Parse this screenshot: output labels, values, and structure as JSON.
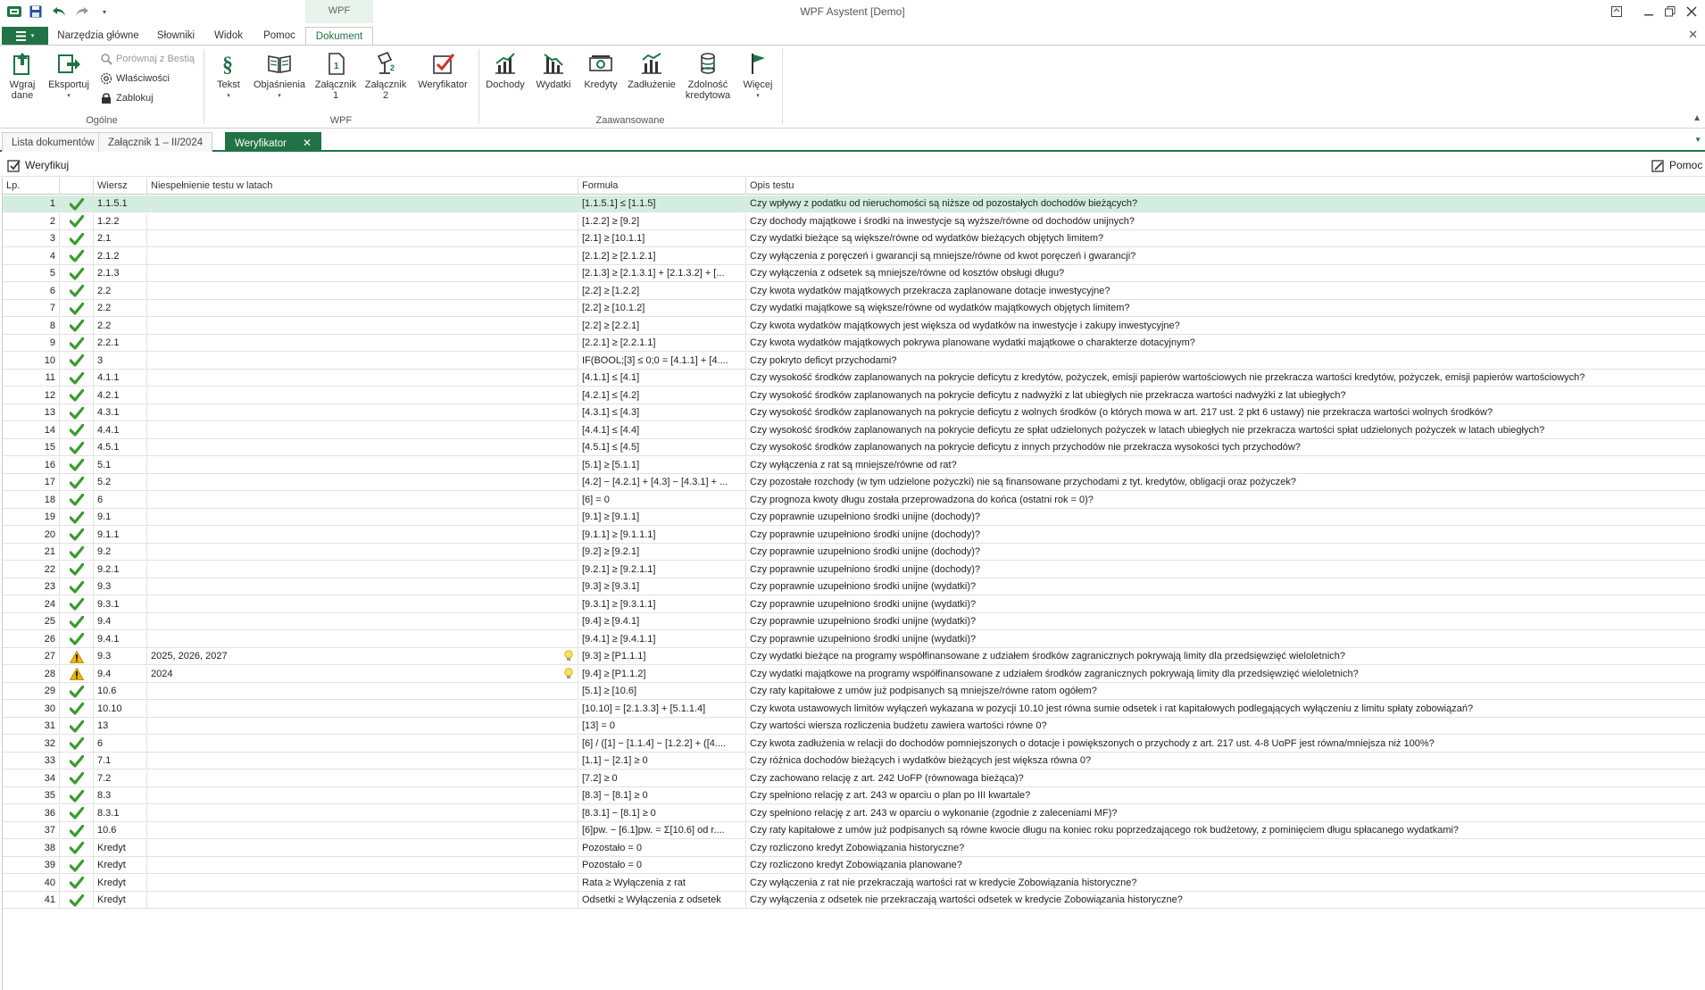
{
  "window": {
    "title": "WPF Asystent [Demo]",
    "context_tab": "WPF"
  },
  "ribbon_tabs": [
    "Narzędzia główne",
    "Słowniki",
    "Widok",
    "Pomoc",
    "Dokument"
  ],
  "ribbon": {
    "ogolne": {
      "label": "Ogólne",
      "wgraj_dane": "Wgraj\ndane",
      "eksportuj": "Eksportuj",
      "porownaj": "Porównaj z Bestią",
      "wlasciwosci": "Właściwości",
      "zablokuj": "Zablokuj"
    },
    "wpf": {
      "label": "WPF",
      "tekst": "Tekst",
      "objasnienia": "Objaśnienia",
      "zalacznik1": "Załącznik\n1",
      "zalacznik2": "Załącznik\n2",
      "weryfikator": "Weryfikator"
    },
    "zaawansowane": {
      "label": "Zaawansowane",
      "dochody": "Dochody",
      "wydatki": "Wydatki",
      "kredyty": "Kredyty",
      "zadluzenie": "Zadłużenie",
      "zdolnosc": "Zdolność\nkredytowa",
      "wiecej": "Więcej"
    }
  },
  "doc_tabs": [
    "Lista dokumentów",
    "Załącznik 1 – II/2024",
    "Weryfikator"
  ],
  "toolbar": {
    "weryfikuj": "Weryfikuj",
    "pomoc": "Pomoc"
  },
  "colors": {
    "accent": "#217346",
    "selected_row": "#d3eee0",
    "ok": "#3a9a2f",
    "warning": "#f0b400"
  },
  "table": {
    "columns": [
      "Lp.",
      "",
      "Wiersz",
      "Niespełnienie testu w latach",
      "Formuła",
      "Opis testu"
    ],
    "rows": [
      {
        "lp": "1",
        "status": "ok",
        "wiersz": "1.1.5.1",
        "lata": "",
        "formula": "[1.1.5.1] ≤ [1.1.5]",
        "opis": "Czy wpływy z podatku od nieruchomości są niższe od pozostałych dochodów bieżących?"
      },
      {
        "lp": "2",
        "status": "ok",
        "wiersz": "1.2.2",
        "lata": "",
        "formula": "[1.2.2] ≥ [9.2]",
        "opis": "Czy dochody majątkowe i środki na inwestycje są wyższe/równe od dochodów unijnych?"
      },
      {
        "lp": "3",
        "status": "ok",
        "wiersz": "2.1",
        "lata": "",
        "formula": "[2.1] ≥ [10.1.1]",
        "opis": "Czy wydatki bieżące są większe/równe od wydatków bieżących objętych limitem?"
      },
      {
        "lp": "4",
        "status": "ok",
        "wiersz": "2.1.2",
        "lata": "",
        "formula": "[2.1.2] ≥ [2.1.2.1]",
        "opis": "Czy wyłączenia z poręczeń i gwarancji są mniejsze/równe od kwot poręczeń i gwarancji?"
      },
      {
        "lp": "5",
        "status": "ok",
        "wiersz": "2.1.3",
        "lata": "",
        "formula": "[2.1.3] ≥ [2.1.3.1] + [2.1.3.2] + [...",
        "opis": "Czy wyłączenia z odsetek są mniejsze/równe od kosztów obsługi długu?"
      },
      {
        "lp": "6",
        "status": "ok",
        "wiersz": "2.2",
        "lata": "",
        "formula": "[2.2] ≥ [1.2.2]",
        "opis": "Czy kwota wydatków majątkowych przekracza zaplanowane dotacje inwestycyjne?"
      },
      {
        "lp": "7",
        "status": "ok",
        "wiersz": "2.2",
        "lata": "",
        "formula": "[2.2] ≥ [10.1.2]",
        "opis": "Czy wydatki majątkowe są większe/równe od wydatków majątkowych objętych limitem?"
      },
      {
        "lp": "8",
        "status": "ok",
        "wiersz": "2.2",
        "lata": "",
        "formula": "[2.2] ≥ [2.2.1]",
        "opis": "Czy kwota wydatków majątkowych jest większa od wydatków na inwestycje i zakupy inwestycyjne?"
      },
      {
        "lp": "9",
        "status": "ok",
        "wiersz": "2.2.1",
        "lata": "",
        "formula": "[2.2.1] ≥ [2.2.1.1]",
        "opis": "Czy kwota wydatków majątkowych pokrywa planowane wydatki majątkowe o charakterze dotacyjnym?"
      },
      {
        "lp": "10",
        "status": "ok",
        "wiersz": "3",
        "lata": "",
        "formula": "IF(BOOL;[3] ≤ 0;0 = [4.1.1] + [4....",
        "opis": "Czy pokryto deficyt przychodami?"
      },
      {
        "lp": "11",
        "status": "ok",
        "wiersz": "4.1.1",
        "lata": "",
        "formula": "[4.1.1] ≤ [4.1]",
        "opis": "Czy wysokość środków zaplanowanych na pokrycie deficytu z kredytów, pożyczek, emisji papierów wartościowych nie przekracza wartości kredytów, pożyczek, emisji papierów wartościowych?"
      },
      {
        "lp": "12",
        "status": "ok",
        "wiersz": "4.2.1",
        "lata": "",
        "formula": "[4.2.1] ≤ [4.2]",
        "opis": "Czy wysokość środków zaplanowanych na pokrycie deficytu z nadwyżki z lat ubiegłych nie przekracza wartości nadwyżki z lat ubiegłych?"
      },
      {
        "lp": "13",
        "status": "ok",
        "wiersz": "4.3.1",
        "lata": "",
        "formula": "[4.3.1] ≤ [4.3]",
        "opis": "Czy wysokość środków zaplanowanych na pokrycie deficytu z wolnych środków (o których mowa w art. 217 ust. 2 pkt 6 ustawy) nie przekracza wartości wolnych środków?"
      },
      {
        "lp": "14",
        "status": "ok",
        "wiersz": "4.4.1",
        "lata": "",
        "formula": "[4.4.1] ≤ [4.4]",
        "opis": "Czy wysokość środków zaplanowanych na pokrycie deficytu ze spłat udzielonych pożyczek w latach ubiegłych nie przekracza wartości spłat udzielonych pożyczek w latach ubiegłych?"
      },
      {
        "lp": "15",
        "status": "ok",
        "wiersz": "4.5.1",
        "lata": "",
        "formula": "[4.5.1] ≤ [4.5]",
        "opis": "Czy wysokość środków zaplanowanych na pokrycie deficytu z innych przychodów nie przekracza wysokości tych przychodów?"
      },
      {
        "lp": "16",
        "status": "ok",
        "wiersz": "5.1",
        "lata": "",
        "formula": "[5.1] ≥ [5.1.1]",
        "opis": "Czy wyłączenia z rat są mniejsze/równe od rat?"
      },
      {
        "lp": "17",
        "status": "ok",
        "wiersz": "5.2",
        "lata": "",
        "formula": "[4.2] − [4.2.1] + [4.3] − [4.3.1] + ...",
        "opis": "Czy pozostałe rozchody (w tym udzielone pożyczki) nie są finansowane przychodami z tyt. kredytów, obligacji oraz pożyczek?"
      },
      {
        "lp": "18",
        "status": "ok",
        "wiersz": "6",
        "lata": "",
        "formula": "[6] = 0",
        "opis": "Czy prognoza kwoty długu została przeprowadzona do końca (ostatni rok = 0)?"
      },
      {
        "lp": "19",
        "status": "ok",
        "wiersz": "9.1",
        "lata": "",
        "formula": "[9.1] ≥ [9.1.1]",
        "opis": "Czy poprawnie uzupełniono środki unijne (dochody)?"
      },
      {
        "lp": "20",
        "status": "ok",
        "wiersz": "9.1.1",
        "lata": "",
        "formula": "[9.1.1] ≥ [9.1.1.1]",
        "opis": "Czy poprawnie uzupełniono środki unijne (dochody)?"
      },
      {
        "lp": "21",
        "status": "ok",
        "wiersz": "9.2",
        "lata": "",
        "formula": "[9.2] ≥ [9.2.1]",
        "opis": "Czy poprawnie uzupełniono środki unijne (dochody)?"
      },
      {
        "lp": "22",
        "status": "ok",
        "wiersz": "9.2.1",
        "lata": "",
        "formula": "[9.2.1] ≥ [9.2.1.1]",
        "opis": "Czy poprawnie uzupełniono środki unijne (dochody)?"
      },
      {
        "lp": "23",
        "status": "ok",
        "wiersz": "9.3",
        "lata": "",
        "formula": "[9.3] ≥ [9.3.1]",
        "opis": "Czy poprawnie uzupełniono środki unijne (wydatki)?"
      },
      {
        "lp": "24",
        "status": "ok",
        "wiersz": "9.3.1",
        "lata": "",
        "formula": "[9.3.1] ≥ [9.3.1.1]",
        "opis": "Czy poprawnie uzupełniono środki unijne (wydatki)?"
      },
      {
        "lp": "25",
        "status": "ok",
        "wiersz": "9.4",
        "lata": "",
        "formula": "[9.4] ≥ [9.4.1]",
        "opis": "Czy poprawnie uzupełniono środki unijne (wydatki)?"
      },
      {
        "lp": "26",
        "status": "ok",
        "wiersz": "9.4.1",
        "lata": "",
        "formula": "[9.4.1] ≥ [9.4.1.1]",
        "opis": "Czy poprawnie uzupełniono środki unijne (wydatki)?"
      },
      {
        "lp": "27",
        "status": "warn",
        "wiersz": "9.3",
        "lata": "2025, 2026, 2027",
        "formula": "[9.3] ≥ [P1.1.1]",
        "opis": "Czy wydatki bieżące na programy współfinansowane z udziałem środków zagranicznych pokrywają limity dla przedsięwzięć wieloletnich?"
      },
      {
        "lp": "28",
        "status": "warn",
        "wiersz": "9.4",
        "lata": "2024",
        "formula": "[9.4] ≥ [P1.1.2]",
        "opis": "Czy wydatki majątkowe na programy współfinansowane z udziałem środków zagranicznych pokrywają limity dla przedsięwzięć wieloletnich?"
      },
      {
        "lp": "29",
        "status": "ok",
        "wiersz": "10.6",
        "lata": "",
        "formula": "[5.1] ≥ [10.6]",
        "opis": "Czy raty kapitałowe z umów już podpisanych są mniejsze/równe ratom ogółem?"
      },
      {
        "lp": "30",
        "status": "ok",
        "wiersz": "10.10",
        "lata": "",
        "formula": "[10.10] = [2.1.3.3] + [5.1.1.4]",
        "opis": "Czy kwota ustawowych limitów wyłączeń wykazana w pozycji 10.10 jest równa sumie odsetek i rat kapitałowych podlegających wyłączeniu z limitu spłaty zobowiązań?"
      },
      {
        "lp": "31",
        "status": "ok",
        "wiersz": "13",
        "lata": "",
        "formula": "[13] = 0",
        "opis": "Czy wartości wiersza rozliczenia budżetu zawiera wartości równe 0?"
      },
      {
        "lp": "32",
        "status": "ok",
        "wiersz": "6",
        "lata": "",
        "formula": "[6] / ([1] − [1.1.4] − [1.2.2] + ([4....",
        "opis": "Czy kwota zadłużenia w relacji do dochodów pomniejszonych o dotacje i powiększonych o przychody z art. 217 ust. 4-8 UoPF jest równa/mniejsza niż 100%?"
      },
      {
        "lp": "33",
        "status": "ok",
        "wiersz": "7.1",
        "lata": "",
        "formula": "[1.1] − [2.1] ≥ 0",
        "opis": "Czy różnica dochodów bieżących i wydatków bieżących jest większa równa 0?"
      },
      {
        "lp": "34",
        "status": "ok",
        "wiersz": "7.2",
        "lata": "",
        "formula": "[7.2] ≥ 0",
        "opis": "Czy zachowano relację z art. 242 UoFP (równowaga bieżąca)?"
      },
      {
        "lp": "35",
        "status": "ok",
        "wiersz": "8.3",
        "lata": "",
        "formula": "[8.3] − [8.1] ≥ 0",
        "opis": "Czy spełniono relację z art. 243 w oparciu o plan po III kwartale?"
      },
      {
        "lp": "36",
        "status": "ok",
        "wiersz": "8.3.1",
        "lata": "",
        "formula": "[8.3.1] − [8.1] ≥ 0",
        "opis": "Czy spełniono relację z art. 243 w oparciu o wykonanie (zgodnie z zaleceniami MF)?"
      },
      {
        "lp": "37",
        "status": "ok",
        "wiersz": "10.6",
        "lata": "",
        "formula": "[6]pw. − [6.1]pw. = Σ[10.6] od r....",
        "opis": "Czy raty kapitałowe z umów już podpisanych są równe kwocie długu na koniec roku poprzedzającego rok budżetowy, z pominięciem długu spłacanego wydatkami?"
      },
      {
        "lp": "38",
        "status": "ok",
        "wiersz": "Kredyt",
        "lata": "",
        "formula": "Pozostało = 0",
        "opis": "Czy rozliczono kredyt Zobowiązania historyczne?"
      },
      {
        "lp": "39",
        "status": "ok",
        "wiersz": "Kredyt",
        "lata": "",
        "formula": "Pozostało = 0",
        "opis": "Czy rozliczono kredyt Zobowiązania planowane?"
      },
      {
        "lp": "40",
        "status": "ok",
        "wiersz": "Kredyt",
        "lata": "",
        "formula": "Rata ≥ Wyłączenia z rat",
        "opis": "Czy wyłączenia z rat nie przekraczają wartości rat w kredycie Zobowiązania historyczne?"
      },
      {
        "lp": "41",
        "status": "ok",
        "wiersz": "Kredyt",
        "lata": "",
        "formula": "Odsetki ≥ Wyłączenia z odsetek",
        "opis": "Czy wyłączenia z odsetek nie przekraczają wartości odsetek w kredycie Zobowiązania historyczne?"
      }
    ]
  }
}
